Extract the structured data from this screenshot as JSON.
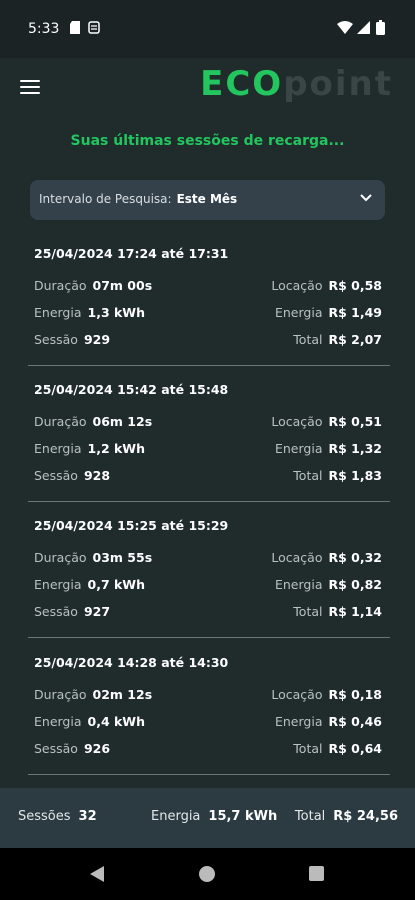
{
  "status_bar": {
    "time": "5:33"
  },
  "app": {
    "logo_eco": "ECO",
    "logo_point": "point"
  },
  "subtitle": "Suas últimas sessões de recarga...",
  "filter": {
    "label": "Intervalo de Pesquisa:",
    "value": "Este Mês"
  },
  "labels": {
    "duracao": "Duração",
    "energia": "Energia",
    "sessao": "Sessão",
    "locacao": "Locação",
    "total": "Total"
  },
  "sessions": [
    {
      "header": "25/04/2024 17:24 até 17:31",
      "duracao": "07m 00s",
      "energia": "1,3 kWh",
      "sessao": "929",
      "locacao": "R$ 0,58",
      "energia_valor": "R$ 1,49",
      "total": "R$ 2,07"
    },
    {
      "header": "25/04/2024 15:42 até 15:48",
      "duracao": "06m 12s",
      "energia": "1,2 kWh",
      "sessao": "928",
      "locacao": "R$ 0,51",
      "energia_valor": "R$ 1,32",
      "total": "R$ 1,83"
    },
    {
      "header": "25/04/2024 15:25 até 15:29",
      "duracao": "03m 55s",
      "energia": "0,7 kWh",
      "sessao": "927",
      "locacao": "R$ 0,32",
      "energia_valor": "R$ 0,82",
      "total": "R$ 1,14"
    },
    {
      "header": "25/04/2024 14:28 até 14:30",
      "duracao": "02m 12s",
      "energia": "0,4 kWh",
      "sessao": "926",
      "locacao": "R$ 0,18",
      "energia_valor": "R$ 0,46",
      "total": "R$ 0,64"
    }
  ],
  "summary": {
    "sessoes_label": "Sessões",
    "sessoes_value": "32",
    "energia_label": "Energia",
    "energia_value": "15,7 kWh",
    "total_label": "Total",
    "total_value": "R$ 24,56"
  },
  "colors": {
    "accent": "#22c55e",
    "background": "#202b2c",
    "footer": "#2c3a42"
  }
}
